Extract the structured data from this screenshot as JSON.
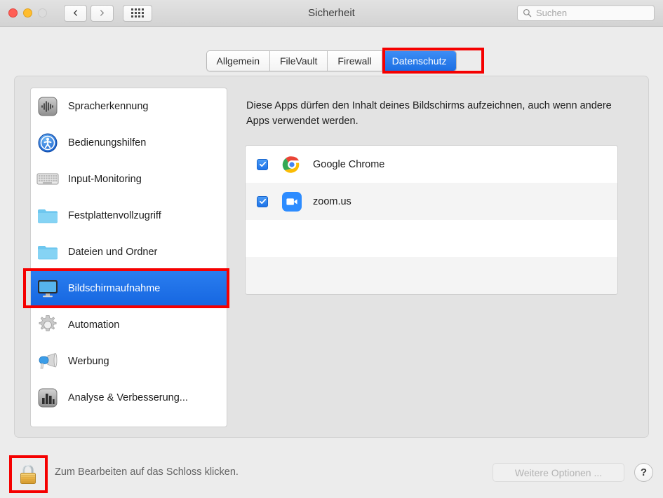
{
  "window": {
    "title": "Sicherheit",
    "traffic_lights": [
      "close",
      "minimize",
      "zoom-disabled"
    ],
    "nav": {
      "back": "back-chevron",
      "forward": "forward-chevron",
      "grid": "show-all-grid"
    },
    "search": {
      "placeholder": "Suchen",
      "value": "",
      "icon": "search-icon"
    }
  },
  "tabs": [
    {
      "label": "Allgemein",
      "active": false
    },
    {
      "label": "FileVault",
      "active": false
    },
    {
      "label": "Firewall",
      "active": false
    },
    {
      "label": "Datenschutz",
      "active": true
    }
  ],
  "sidebar": {
    "items": [
      {
        "label": "Spracherkennung",
        "icon": "waveform-icon",
        "selected": false
      },
      {
        "label": "Bedienungshilfen",
        "icon": "accessibility-icon",
        "selected": false
      },
      {
        "label": "Input-Monitoring",
        "icon": "keyboard-icon",
        "selected": false
      },
      {
        "label": "Festplattenvollzugriff",
        "icon": "folder-icon",
        "selected": false
      },
      {
        "label": "Dateien und Ordner",
        "icon": "folder-icon",
        "selected": false
      },
      {
        "label": "Bildschirmaufnahme",
        "icon": "display-icon",
        "selected": true
      },
      {
        "label": "Automation",
        "icon": "gear-icon",
        "selected": false
      },
      {
        "label": "Werbung",
        "icon": "megaphone-icon",
        "selected": false
      },
      {
        "label": "Analyse & Verbesserung...",
        "icon": "bar-chart-icon",
        "selected": false
      }
    ]
  },
  "content": {
    "description": "Diese Apps dürfen den Inhalt deines Bildschirms aufzeichnen, auch wenn andere Apps verwendet werden.",
    "apps": [
      {
        "name": "Google Chrome",
        "icon": "chrome-icon",
        "checked": true
      },
      {
        "name": "zoom.us",
        "icon": "zoom-icon",
        "checked": true
      }
    ]
  },
  "bottom": {
    "lock_icon": "lock-closed-icon",
    "lock_hint": "Zum Bearbeiten auf das Schloss klicken.",
    "more_options_label": "Weitere Optionen ...",
    "more_options_disabled": true,
    "help_label": "?"
  },
  "annotations": {
    "accent_color": "#f50000",
    "boxes": [
      "datenschutz-tab",
      "bildschirmaufnahme-row",
      "lock-button"
    ]
  }
}
